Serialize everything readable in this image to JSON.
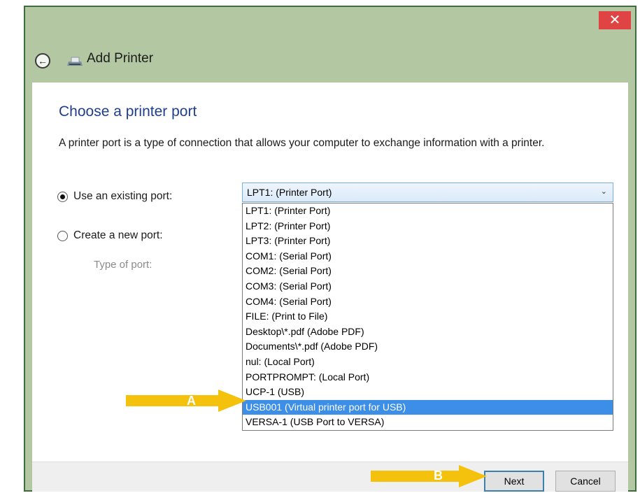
{
  "window": {
    "title": "Add Printer",
    "close_glyph": "✕",
    "back_glyph": "←",
    "colors": {
      "frame": "#b3c8a2",
      "close": "#e04343",
      "heading": "#1f3e8c",
      "highlight": "#3c8ee6"
    }
  },
  "page": {
    "heading": "Choose a printer port",
    "description": "A printer port is a type of connection that allows your computer to exchange information with a printer.",
    "existing_port_label": "Use an existing port:",
    "new_port_label": "Create a new port:",
    "type_of_port_label": "Type of port:",
    "selected_value": "LPT1: (Printer Port)",
    "options": [
      "LPT1: (Printer Port)",
      "LPT2: (Printer Port)",
      "LPT3: (Printer Port)",
      "COM1: (Serial Port)",
      "COM2: (Serial Port)",
      "COM3: (Serial Port)",
      "COM4: (Serial Port)",
      "FILE: (Print to File)",
      "Desktop\\*.pdf (Adobe PDF)",
      "Documents\\*.pdf (Adobe PDF)",
      "nul: (Local Port)",
      "PORTPROMPT: (Local Port)",
      "UCP-1 (USB)",
      "USB001 (Virtual printer port for USB)",
      "VERSA-1 (USB Port to VERSA)"
    ],
    "highlighted_option": "USB001 (Virtual printer port for USB)"
  },
  "footer": {
    "next_label": "Next",
    "cancel_label": "Cancel"
  },
  "annotations": {
    "arrow_a_label": "A",
    "arrow_b_label": "B",
    "arrow_color": "#f4c20d"
  },
  "icons": [
    "back-arrow-icon",
    "printer-icon",
    "close-icon",
    "chevron-down-icon"
  ]
}
